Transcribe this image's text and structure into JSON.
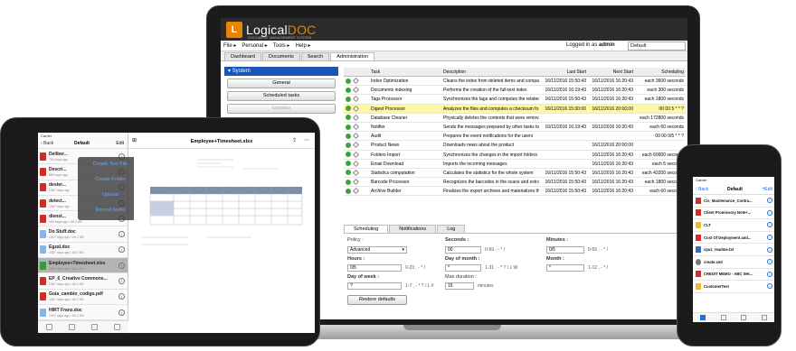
{
  "laptop": {
    "logo_left": "Logical",
    "logo_right": "DOC",
    "logo_tagline": "DOCUMENT MANAGEMENT SYSTEM",
    "menus": [
      "File",
      "Personal",
      "Tools",
      "Help"
    ],
    "logged_prefix": "Logged in as",
    "logged_user": "admin",
    "workspace": "Default",
    "tabs": [
      "Dashboard",
      "Documents",
      "Search",
      "Administration"
    ],
    "active_tab": "Administration",
    "left_panel": {
      "section": "System",
      "buttons": [
        "General",
        "Scheduled tasks",
        "Updates"
      ]
    },
    "grid": {
      "headers": [
        "Task",
        "Description",
        "Last Start",
        "Next Start",
        "Scheduling"
      ],
      "rows": [
        {
          "task": "Index Optimization",
          "desc": "Cleans the index from deleted items and compac...",
          "last": "16/11/2016 15:50:43",
          "next": "16/11/2016 16:20:43",
          "sched": "each 3600 seconds",
          "hl": false
        },
        {
          "task": "Documents indexing",
          "desc": "Performs the creation of the full-text index",
          "last": "16/11/2016 16:19:43",
          "next": "16/11/2016 16:20:43",
          "sched": "each 300 seconds",
          "hl": false
        },
        {
          "task": "Tags Processor",
          "desc": "Synchronizes the tags and computes the related stati...",
          "last": "16/11/2016 15:50:43",
          "next": "16/11/2016 16:20:43",
          "sched": "each 1800 seconds",
          "hl": false
        },
        {
          "task": "Digest Processor",
          "desc": "Analyzes the files and computes a checksum fo...",
          "last": "16/11/2016 15:00:00",
          "next": "16/11/2016 20:00:00",
          "sched": "00 00 5 * * ?",
          "hl": true
        },
        {
          "task": "Database Cleaner",
          "desc": "Physically deletes the contents that were remov...",
          "last": "",
          "next": "",
          "sched": "each 172800 seconds",
          "hl": false
        },
        {
          "task": "Notifier",
          "desc": "Sends the messages prepared by other tasks to",
          "last": "16/11/2016 16:19:43",
          "next": "16/11/2016 16:20:43",
          "sched": "each 60 seconds",
          "hl": false
        },
        {
          "task": "Audit",
          "desc": "Prepares the event notifications for the users",
          "last": "",
          "next": "",
          "sched": "00 00 0/5 * * ?",
          "hl": false
        },
        {
          "task": "Product News",
          "desc": "Downloads news about the product",
          "last": "",
          "next": "16/11/2016 20:00:00",
          "sched": "",
          "hl": false
        },
        {
          "task": "Folders Import",
          "desc": "Synchronizes the changes in the import folders ...",
          "last": "",
          "next": "16/11/2016 16:20:43",
          "sched": "each 60000 seconds",
          "hl": false
        },
        {
          "task": "Email Download",
          "desc": "Imports the incoming messages",
          "last": "",
          "next": "16/11/2016 16:20:43",
          "sched": "each 5 seconds",
          "hl": false
        },
        {
          "task": "Statistics computation",
          "desc": "Calculates the statistics for the whole system",
          "last": "16/11/2016 15:50:43",
          "next": "16/11/2016 16:20:43",
          "sched": "each 43200 seconds",
          "hl": false
        },
        {
          "task": "Barcode Processor",
          "desc": "Recognizes the barcodes in the scans and extra...",
          "last": "16/11/2016 15:50:43",
          "next": "16/11/2016 16:20:43",
          "sched": "each 1800 seconds",
          "hl": false
        },
        {
          "task": "Archive Builder",
          "desc": "Finalizes the export archives and materializes th...",
          "last": "16/11/2016 15:50:43",
          "next": "16/11/2016 16:20:43",
          "sched": "each 60 seconds",
          "hl": false
        }
      ]
    },
    "subtabs": [
      "Scheduling",
      "Notifications",
      "Log"
    ],
    "form": {
      "policy_label": "Policy :",
      "policy_value": "Advanced",
      "seconds_label": "Seconds :",
      "seconds_value": "00",
      "seconds_hint": "0-59 , - * /",
      "minutes_label": "Minutes :",
      "minutes_value": "0/5",
      "minutes_hint": "0-59 , - * /",
      "hours_label": "Hours :",
      "hours_value": "0/5",
      "hours_hint": "0-23 , - * /",
      "dom_label": "Day of month :",
      "dom_value": "*",
      "dom_hint": "1-31 , - * ? / L W",
      "month_label": "Month :",
      "month_value": "*",
      "month_hint": "1-12 , - * /",
      "dow_label": "Day of week :",
      "dow_value": "?",
      "dow_hint": "1-7 , - * ? / L #",
      "maxdur_label": "Max duration :",
      "maxdur_value": "15",
      "maxdur_unit": "minutes",
      "restore": "Restore defaults"
    }
  },
  "ipad": {
    "status": "Carrier",
    "nav_back": "Back",
    "nav_title": "Default",
    "nav_edit": "Edit",
    "doc_title": "Employee+Timesheet.xlsx",
    "menu": [
      "Create Text File",
      "Create Folder",
      "Upload",
      "Record Audio"
    ],
    "files": [
      {
        "name": "Deliber...",
        "meta": "750 days ago",
        "type": "pdf"
      },
      {
        "name": "Descri...",
        "meta": "689 days ago",
        "type": "pdf"
      },
      {
        "name": "dester...",
        "meta": "1067 days ago",
        "type": "pdf"
      },
      {
        "name": "detect...",
        "meta": "1067 days ago",
        "type": "pdf"
      },
      {
        "name": "dienst...",
        "meta": "693 days ago • 60.2 KB",
        "type": "pdf"
      },
      {
        "name": "Do Stuff.doc",
        "meta": "1067 days ago • 60.2 KB",
        "type": "doc"
      },
      {
        "name": "Egzal.doc",
        "meta": "1067 days ago • 60.2 KB",
        "type": "doc"
      },
      {
        "name": "Employee+Timesheet.xlsx",
        "meta": "1067 days ago • 60.2 KB",
        "type": "xls",
        "sel": true
      },
      {
        "name": "EP_6_Creative Commons...",
        "meta": "1067 days ago • 60.2 KB",
        "type": "pdf"
      },
      {
        "name": "Guia_cambio_codigo.pdf",
        "meta": "1067 days ago • 60.2 KB",
        "type": "pdf"
      },
      {
        "name": "HIRT Franz.doc",
        "meta": "1067 days ago • 60.2 KB",
        "type": "doc"
      }
    ]
  },
  "iphone": {
    "status": "Carrier",
    "nav_back": "Back",
    "nav_title": "Default",
    "nav_add": "+",
    "nav_edit": "Edit",
    "files": [
      {
        "name": "Cis_Maintenance_Contra...",
        "meta": "",
        "type": "pdf"
      },
      {
        "name": "Client Promissory Note+...",
        "meta": "",
        "type": "pdf"
      },
      {
        "name": "CLT",
        "meta": "",
        "type": "folder"
      },
      {
        "name": "Cost Of Deployment and...",
        "meta": "",
        "type": "pdf"
      },
      {
        "name": "cpuz_readme.txt",
        "meta": "",
        "type": "doc"
      },
      {
        "name": "create.xml",
        "meta": "",
        "type": "gear"
      },
      {
        "name": "CREDIT MEMO - ABC SHI...",
        "meta": "",
        "type": "pdf"
      },
      {
        "name": "CustomerTest",
        "meta": "",
        "type": "folder"
      }
    ]
  }
}
